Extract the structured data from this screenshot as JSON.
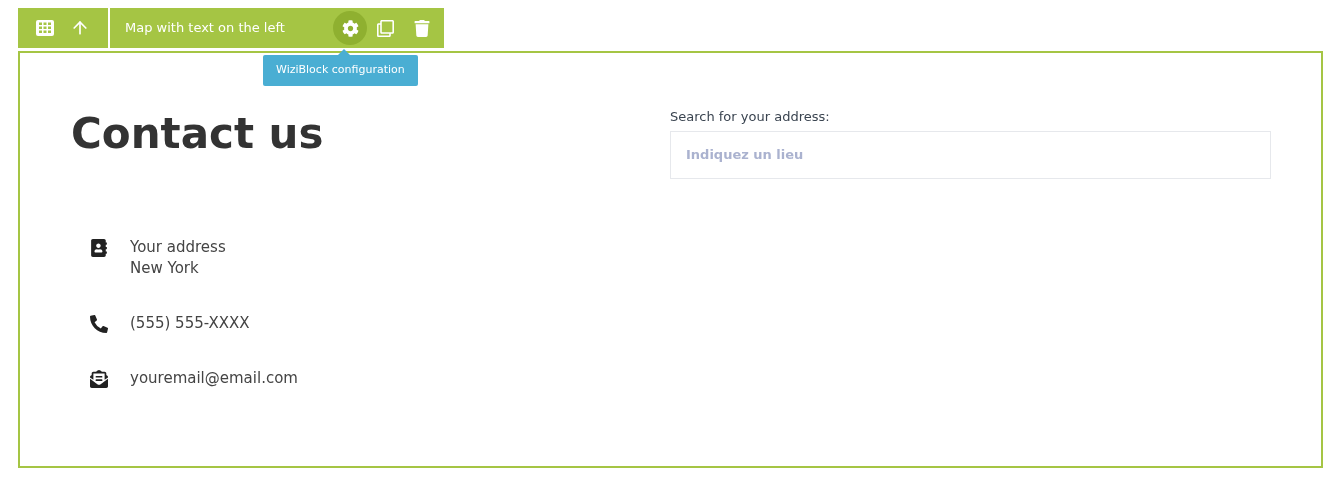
{
  "toolbar": {
    "block_name": "Map with text on the left",
    "tooltip": "WiziBlock configuration"
  },
  "heading": "Contact us",
  "contacts": [
    {
      "kind": "address",
      "lines": [
        "Your address",
        "New York"
      ]
    },
    {
      "kind": "phone",
      "lines": [
        "(555) 555-XXXX"
      ]
    },
    {
      "kind": "email",
      "lines": [
        "youremail@email.com"
      ]
    }
  ],
  "search": {
    "label": "Search for your address:",
    "placeholder": "Indiquez un lieu"
  }
}
